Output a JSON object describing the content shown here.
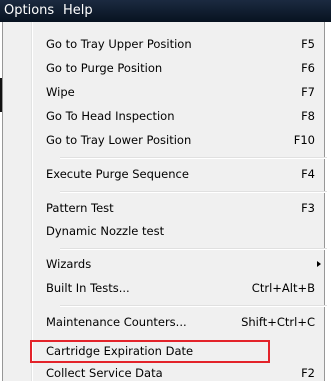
{
  "menubar": {
    "options_label": "Options",
    "help_label": "Help"
  },
  "menu": {
    "items": [
      {
        "label": "Go to Tray Upper Position",
        "shortcut": "F5"
      },
      {
        "label": "Go to Purge Position",
        "shortcut": "F6"
      },
      {
        "label": "Wipe",
        "shortcut": "F7"
      },
      {
        "label": "Go To Head Inspection",
        "shortcut": "F8"
      },
      {
        "label": "Go to Tray Lower Position",
        "shortcut": "F10"
      },
      {
        "label": "Execute Purge Sequence",
        "shortcut": "F4"
      },
      {
        "label": "Pattern Test",
        "shortcut": "F3"
      },
      {
        "label": "Dynamic Nozzle test",
        "shortcut": ""
      },
      {
        "label": "Wizards",
        "shortcut": ""
      },
      {
        "label": "Built In Tests...",
        "shortcut": "Ctrl+Alt+B"
      },
      {
        "label": "Maintenance Counters...",
        "shortcut": "Shift+Ctrl+C"
      },
      {
        "label": "Cartridge Expiration Date",
        "shortcut": ""
      },
      {
        "label": "Collect Service Data",
        "shortcut": "F2"
      }
    ]
  },
  "highlight_color": "#e3232a"
}
